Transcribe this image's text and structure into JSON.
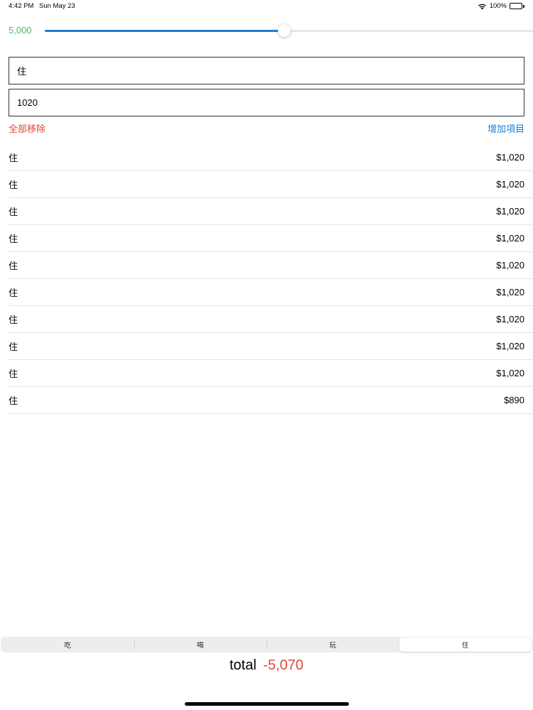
{
  "status_bar": {
    "time": "4:42 PM",
    "date": "Sun May 23",
    "battery_text": "100%",
    "battery_level": 1.0
  },
  "slider": {
    "value_label": "5,000",
    "fill_fraction": 0.49,
    "accent_color": "#1a7fd4",
    "value_color": "#4cb96b"
  },
  "form": {
    "name_value": "住",
    "amount_value": "1020"
  },
  "actions": {
    "remove_all": "全部移除",
    "add_item": "增加項目",
    "remove_color": "#e2453b",
    "add_color": "#1a7fd4"
  },
  "items": [
    {
      "name": "住",
      "amount": "$1,020"
    },
    {
      "name": "住",
      "amount": "$1,020"
    },
    {
      "name": "住",
      "amount": "$1,020"
    },
    {
      "name": "住",
      "amount": "$1,020"
    },
    {
      "name": "住",
      "amount": "$1,020"
    },
    {
      "name": "住",
      "amount": "$1,020"
    },
    {
      "name": "住",
      "amount": "$1,020"
    },
    {
      "name": "住",
      "amount": "$1,020"
    },
    {
      "name": "住",
      "amount": "$1,020"
    },
    {
      "name": "住",
      "amount": "$890"
    }
  ],
  "segments": {
    "options": [
      "吃",
      "喝",
      "玩",
      "住"
    ],
    "selected": "住"
  },
  "total": {
    "label": "total",
    "value": "-5,070",
    "value_color": "#e2453b"
  },
  "icons": [
    "wifi-icon",
    "battery-icon"
  ]
}
